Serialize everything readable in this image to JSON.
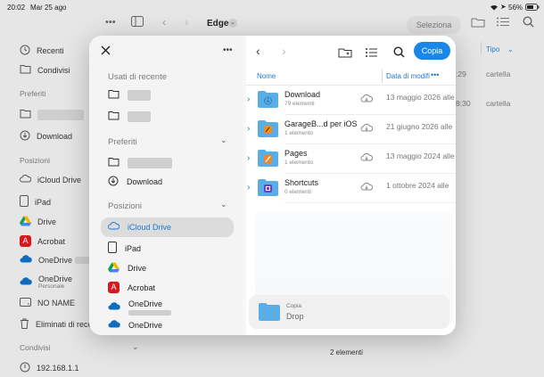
{
  "status_bar": {
    "time": "20:02",
    "date": "Mar 25 ago",
    "battery": "56%"
  },
  "background": {
    "toolbar": {
      "title": "Edge",
      "select_label": "Seleziona"
    },
    "sidebar": {
      "recents": "Recenti",
      "shared": "Condivisi",
      "favorites_header": "Preferiti",
      "download": "Download",
      "locations_header": "Posizioni",
      "locations": [
        {
          "label": "iCloud Drive",
          "icon": "cloud-icon"
        },
        {
          "label": "iPad",
          "icon": "ipad-icon"
        },
        {
          "label": "Drive",
          "icon": "google-drive-icon"
        },
        {
          "label": "Acrobat",
          "icon": "acrobat-icon"
        },
        {
          "label": "OneDrive",
          "icon": "onedrive-icon"
        },
        {
          "label": "OneDrive",
          "icon": "onedrive-icon"
        },
        {
          "label": "NO NAME",
          "icon": "drive-icon"
        },
        {
          "label": "Eliminati di rece",
          "icon": "trash-icon"
        }
      ],
      "onedrive_personal_sub": "Personale",
      "shared_header": "Condivisi",
      "server": "192.168.1.1"
    },
    "list": {
      "type_header": "Tipo",
      "row1_type": "cartella",
      "row2_type": "cartella",
      "row1_time": ":29",
      "row2_time": "8:30"
    },
    "footer_count": "2 elementi"
  },
  "modal": {
    "sidebar": {
      "recent_header": "Usati di recente",
      "favorites_header": "Preferiti",
      "download": "Download",
      "locations_header": "Posizioni",
      "locations": [
        {
          "label": "iCloud Drive",
          "icon": "cloud-icon",
          "selected": true
        },
        {
          "label": "iPad",
          "icon": "ipad-icon"
        },
        {
          "label": "Drive",
          "icon": "google-drive-icon"
        },
        {
          "label": "Acrobat",
          "icon": "acrobat-icon"
        },
        {
          "label": "OneDrive",
          "icon": "onedrive-icon"
        },
        {
          "label": "OneDrive",
          "icon": "onedrive-icon"
        }
      ]
    },
    "toolbar": {
      "copy_button": "Copia"
    },
    "columns": {
      "name": "Nome",
      "date": "Data di modifi"
    },
    "rows": [
      {
        "name": "Download",
        "sub": "79 elementi",
        "date": "13 maggio 2026 alle",
        "icon": "download-folder-icon"
      },
      {
        "name": "GarageB...d per iOS",
        "sub": "1 elemento",
        "date": "21 giugno 2026 alle",
        "icon": "garageband-folder-icon"
      },
      {
        "name": "Pages",
        "sub": "1 elemento",
        "date": "13 maggio 2024 alle",
        "icon": "pages-folder-icon"
      },
      {
        "name": "Shortcuts",
        "sub": "0 elementi",
        "date": "1 ottobre 2024 alle",
        "icon": "shortcuts-folder-icon"
      }
    ],
    "drop": {
      "title": "Copia",
      "label": "Drop"
    }
  },
  "colors": {
    "accent": "#1a86e8",
    "folder": "#5aaee6"
  }
}
